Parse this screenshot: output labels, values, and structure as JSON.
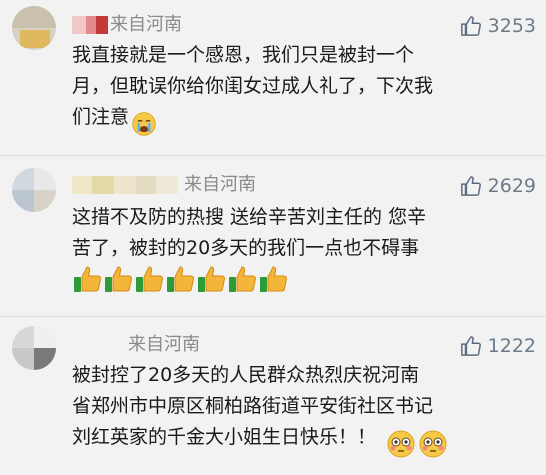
{
  "comments": [
    {
      "location": "来自河南",
      "likes": "3253",
      "lines": [
        "我直接就是一个感恩，我们只是被封一个",
        "月，但耽误你给你闺女过成人礼了，下次我",
        "们注意"
      ],
      "trailing_emoji": "crying-face"
    },
    {
      "location": "来自河南",
      "likes": "2629",
      "lines": [
        "这措不及防的热搜 送给辛苦刘主任的 您辛",
        "苦了，被封的20多天的我们一点也不碍事"
      ],
      "emoji_row": [
        "thumbs-up",
        "thumbs-up",
        "thumbs-up",
        "thumbs-up",
        "thumbs-up",
        "thumbs-up",
        "thumbs-up"
      ]
    },
    {
      "location": "来自河南",
      "likes": "1222",
      "lines": [
        "被封控了20多天的人民群众热烈庆祝河南",
        "省郑州市中原区桐柏路街道平安街社区书记",
        "刘红英家的千金大小姐生日快乐！！"
      ],
      "trailing_emoji": "flushed-face x2"
    }
  ],
  "colors": {
    "background": "#f2f2f2",
    "location_text": "#8a8a8a",
    "like_icon": "#5a6b7d",
    "separator": "#dcdcdc"
  }
}
